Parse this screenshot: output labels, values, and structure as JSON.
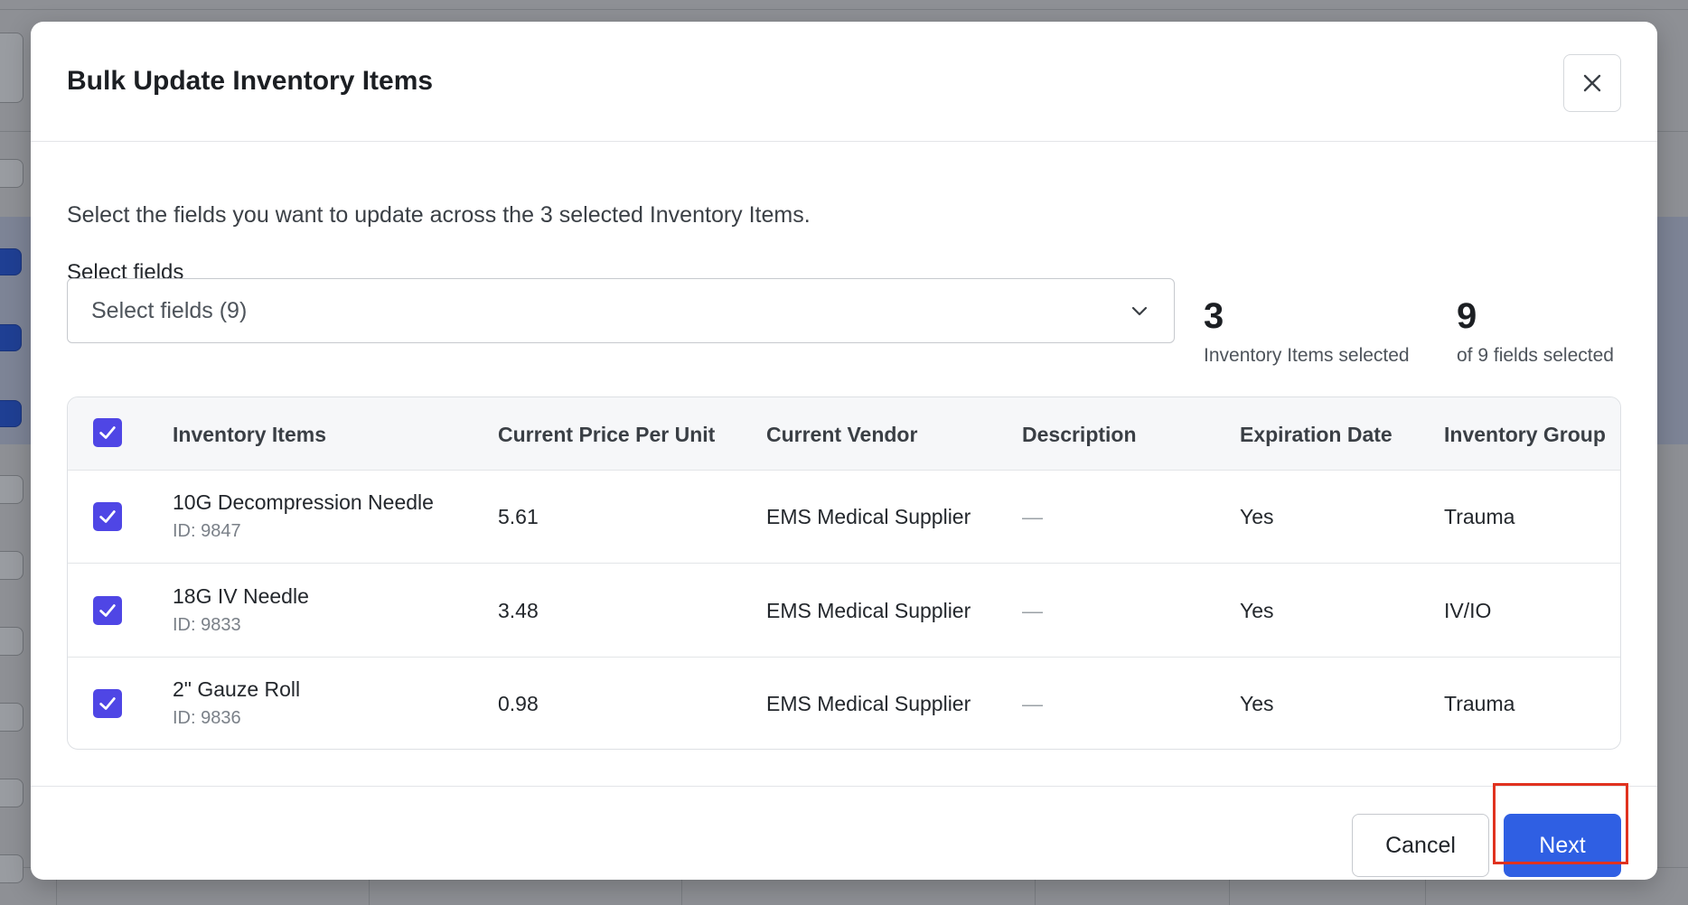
{
  "modal": {
    "title": "Bulk Update Inventory Items",
    "intro": "Select the fields you want to update across the 3 selected Inventory Items.",
    "fields_label": "Select fields",
    "select_placeholder": "Select fields (9)"
  },
  "stats": {
    "items_count": "3",
    "items_label": "Inventory Items selected",
    "fields_count": "9",
    "fields_label": "of 9 fields selected"
  },
  "table": {
    "header_checked": true,
    "columns": [
      "Inventory Items",
      "Current Price Per Unit",
      "Current Vendor",
      "Description",
      "Expiration Date",
      "Inventory Group"
    ],
    "rows": [
      {
        "checked": true,
        "name": "10G Decompression Needle",
        "id": "ID: 9847",
        "price": "5.61",
        "vendor": "EMS Medical Supplier",
        "description": "—",
        "expiration": "Yes",
        "group": "Trauma"
      },
      {
        "checked": true,
        "name": "18G IV Needle",
        "id": "ID: 9833",
        "price": "3.48",
        "vendor": "EMS Medical Supplier",
        "description": "—",
        "expiration": "Yes",
        "group": "IV/IO"
      },
      {
        "checked": true,
        "name": "2\" Gauze Roll",
        "id": "ID: 9836",
        "price": "0.98",
        "vendor": "EMS Medical Supplier",
        "description": "—",
        "expiration": "Yes",
        "group": "Trauma"
      }
    ]
  },
  "footer": {
    "cancel_label": "Cancel",
    "next_label": "Next"
  },
  "icons": {
    "close": "close-icon",
    "chevron": "chevron-down-icon",
    "check": "check-icon"
  },
  "colors": {
    "checkbox": "#4f46e5",
    "primary_button": "#2f5fe3",
    "highlight": "#e0321f"
  }
}
